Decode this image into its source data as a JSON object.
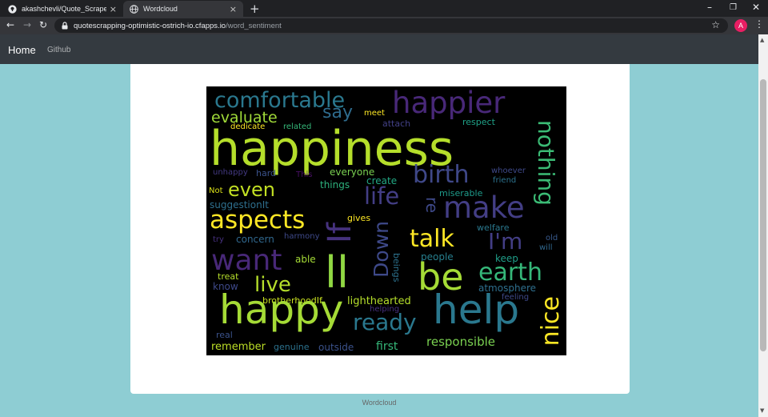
{
  "browser": {
    "tabs": [
      {
        "title": "akashchevli/Quote_Scraper",
        "icon": "github-icon"
      },
      {
        "title": "Wordcloud",
        "icon": "globe-icon"
      }
    ],
    "new_tab": "+",
    "url_host": "quotescrapping-optimistic-ostrich-io.cfapps.io",
    "url_path": "/word_sentiment",
    "profile_initial": "A",
    "profile_color": "#e91e63"
  },
  "navbar": {
    "brand": "Home",
    "links": [
      "Github"
    ]
  },
  "footer": {
    "text": "Wordcloud"
  },
  "wordcloud": {
    "background": "#000000",
    "words": [
      {
        "text": "happiness"
      },
      {
        "text": "comfortable"
      },
      {
        "text": "happier"
      },
      {
        "text": "evaluate"
      },
      {
        "text": "say"
      },
      {
        "text": "meet"
      },
      {
        "text": "attach"
      },
      {
        "text": "respect"
      },
      {
        "text": "nothing"
      },
      {
        "text": "dedicate"
      },
      {
        "text": "related"
      },
      {
        "text": "birth"
      },
      {
        "text": "unhappy"
      },
      {
        "text": "hard"
      },
      {
        "text": "This"
      },
      {
        "text": "everyone"
      },
      {
        "text": "whoever"
      },
      {
        "text": "friend"
      },
      {
        "text": "even"
      },
      {
        "text": "create"
      },
      {
        "text": "Not"
      },
      {
        "text": "things"
      },
      {
        "text": "life"
      },
      {
        "text": "miserable"
      },
      {
        "text": "make"
      },
      {
        "text": "suggestionIt"
      },
      {
        "text": "aspects"
      },
      {
        "text": "If"
      },
      {
        "text": "re"
      },
      {
        "text": "gives"
      },
      {
        "text": "welfare"
      },
      {
        "text": "talk"
      },
      {
        "text": "I'm"
      },
      {
        "text": "try"
      },
      {
        "text": "concern"
      },
      {
        "text": "harmony"
      },
      {
        "text": "old"
      },
      {
        "text": "will"
      },
      {
        "text": "want"
      },
      {
        "text": "Down"
      },
      {
        "text": "ll"
      },
      {
        "text": "able"
      },
      {
        "text": "people"
      },
      {
        "text": "keep"
      },
      {
        "text": "be"
      },
      {
        "text": "treat"
      },
      {
        "text": "earth"
      },
      {
        "text": "live"
      },
      {
        "text": "know"
      },
      {
        "text": "beings"
      },
      {
        "text": "atmosphere"
      },
      {
        "text": "brotherhoodIf"
      },
      {
        "text": "lighthearted"
      },
      {
        "text": "feeling"
      },
      {
        "text": "happy"
      },
      {
        "text": "helping"
      },
      {
        "text": "help"
      },
      {
        "text": "ready"
      },
      {
        "text": "nice"
      },
      {
        "text": "real"
      },
      {
        "text": "remember"
      },
      {
        "text": "genuine"
      },
      {
        "text": "outside"
      },
      {
        "text": "first"
      },
      {
        "text": "responsible"
      }
    ]
  }
}
